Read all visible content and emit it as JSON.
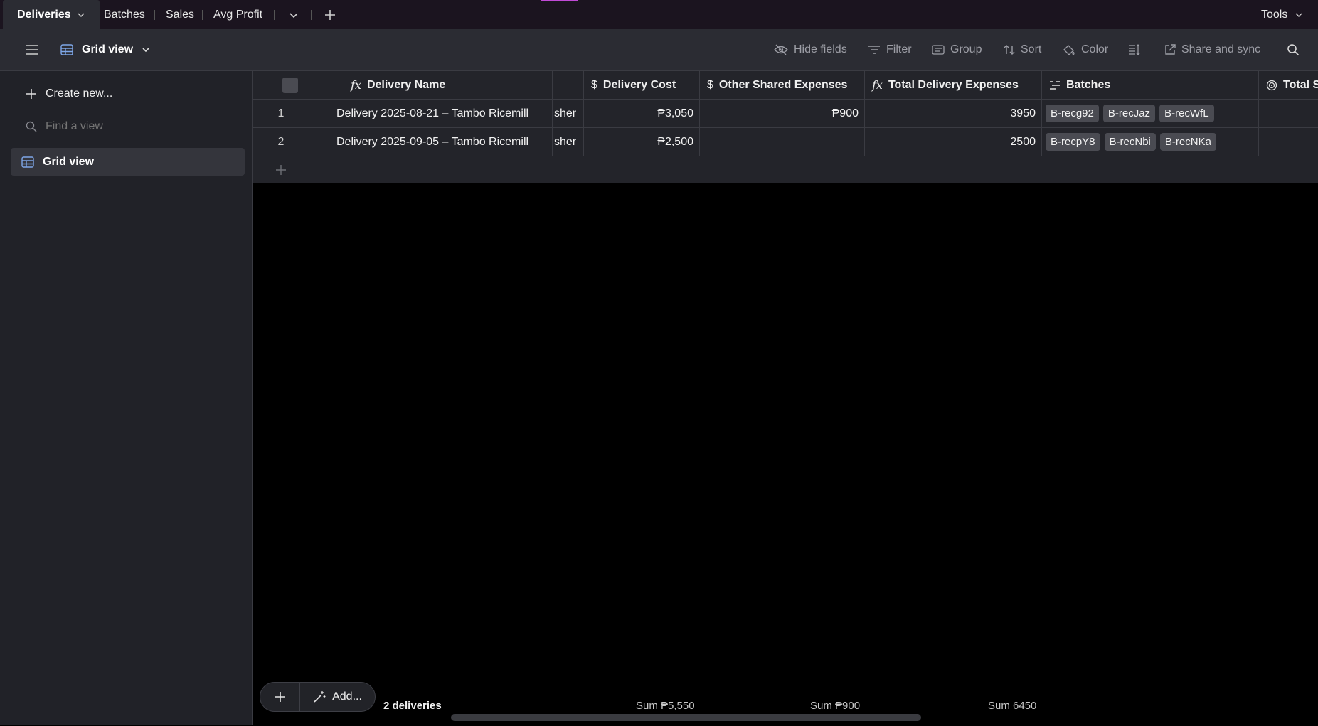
{
  "tabs": {
    "active": "Deliveries",
    "items": [
      "Batches",
      "Sales",
      "Avg Profit"
    ],
    "tools": "Tools"
  },
  "toolbar": {
    "view_name": "Grid view",
    "hide_fields": "Hide fields",
    "filter": "Filter",
    "group": "Group",
    "sort": "Sort",
    "color": "Color",
    "share": "Share and sync"
  },
  "sidebar": {
    "create_new": "Create new...",
    "find_placeholder": "Find a view",
    "views": [
      "Grid view"
    ]
  },
  "table": {
    "headers": {
      "name": "Delivery Name",
      "cost": "Delivery Cost",
      "other": "Other Shared Expenses",
      "total": "Total Delivery Expenses",
      "batches": "Batches",
      "total_sales": "Total Sa"
    },
    "rows": [
      {
        "num": "1",
        "name": "Delivery 2025-08-21 – Tambo Ricemill",
        "partial": "sher",
        "cost": "₱3,050",
        "other": "₱900",
        "total": "3950",
        "batches": [
          "B-recg92",
          "B-recJaz",
          "B-recWfL"
        ]
      },
      {
        "num": "2",
        "name": "Delivery 2025-09-05 – Tambo Ricemill",
        "partial": "sher",
        "cost": "₱2,500",
        "other": "",
        "total": "2500",
        "batches": [
          "B-recpY8",
          "B-recNbi",
          "B-recNKa"
        ]
      }
    ]
  },
  "footer": {
    "add_label": "Add...",
    "count": "2 deliveries",
    "sum_cost": "Sum ₱5,550",
    "sum_other": "Sum ₱900",
    "sum_total": "Sum 6450"
  },
  "colors": {
    "tabbar_bg": "#1b141f",
    "toolbar_bg": "#2b2c33",
    "sidebar_bg": "#212228",
    "grid_bg": "#23242a",
    "chip_bg": "#4a4b52",
    "accent": "#c14ad6"
  }
}
